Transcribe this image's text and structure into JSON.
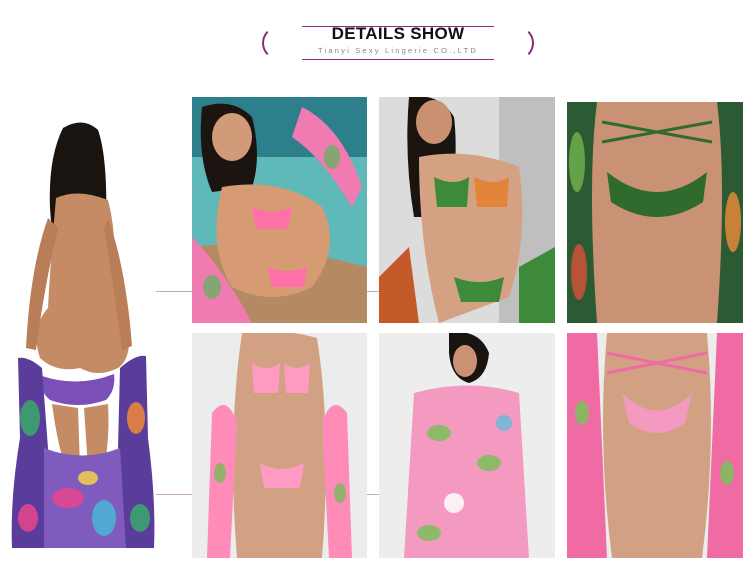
{
  "header": {
    "title": "DETAILS SHOW",
    "subtitle": "Tianyi Sexy Lingerie CO.,LTD"
  },
  "photos": [
    {
      "name": "full-back-view-photo",
      "accent": "#6b3fa0"
    },
    {
      "name": "beach-front-view-photo",
      "accent": "#ff6fa8"
    },
    {
      "name": "front-triangle-top-photo",
      "accent": "#3c8a3a"
    },
    {
      "name": "waist-tie-detail-photo",
      "accent": "#2f6b2c"
    },
    {
      "name": "front-full-set-photo",
      "accent": "#ff8cb8"
    },
    {
      "name": "cover-up-back-photo",
      "accent": "#f49ac1"
    },
    {
      "name": "bottom-detail-photo",
      "accent": "#f06aa4"
    }
  ],
  "colors": {
    "frame": "#8a2a7c",
    "connector": "#c9a7c4"
  }
}
